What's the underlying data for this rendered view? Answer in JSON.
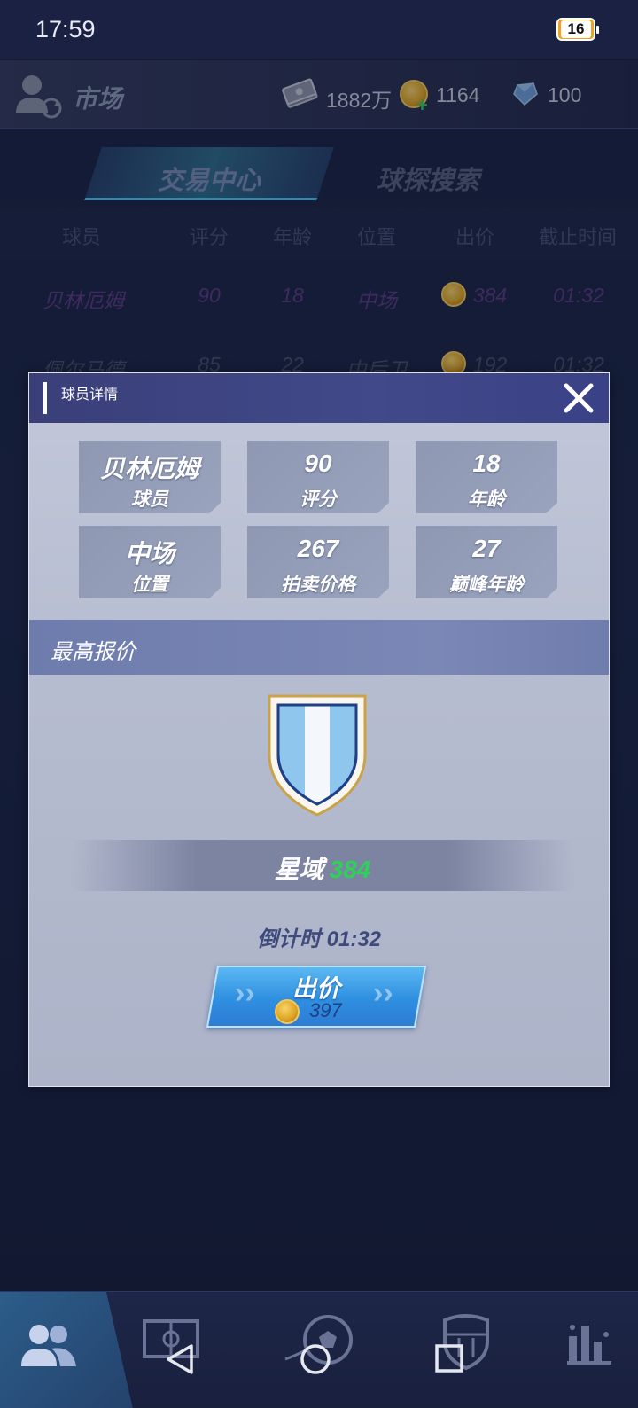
{
  "status_bar": {
    "time": "17:59",
    "battery": "16"
  },
  "header": {
    "title": "市场",
    "cash": "1882万",
    "coins": "1164",
    "gems": "100"
  },
  "tabs": [
    {
      "label": "交易中心",
      "active": true
    },
    {
      "label": "球探搜索",
      "active": false
    }
  ],
  "table": {
    "headers": [
      "球员",
      "评分",
      "年龄",
      "位置",
      "出价",
      "截止时间"
    ],
    "rows": [
      {
        "player": "贝林厄姆",
        "rating": "90",
        "age": "18",
        "position": "中场",
        "bid": "384",
        "deadline": "01:32"
      },
      {
        "player": "佩尔马德",
        "rating": "85",
        "age": "22",
        "position": "中后卫",
        "bid": "192",
        "deadline": "01:32"
      }
    ]
  },
  "dialog": {
    "title": "球员详情",
    "stats": [
      {
        "value": "贝林厄姆",
        "label": "球员"
      },
      {
        "value": "90",
        "label": "评分"
      },
      {
        "value": "18",
        "label": "年龄"
      },
      {
        "value": "中场",
        "label": "位置"
      },
      {
        "value": "267",
        "label": "拍卖价格"
      },
      {
        "value": "27",
        "label": "巅峰年龄"
      }
    ],
    "section_title": "最高报价",
    "top_bidder": "星域",
    "top_bid": "384",
    "countdown": "倒计时 01:32",
    "bid_button": {
      "label": "出价",
      "price": "397"
    }
  },
  "colors": {
    "accent_green": "#2fd05a",
    "button_blue": "#2f8fe0",
    "coin_gold": "#e1a726"
  },
  "icons": [
    "user-refresh-icon",
    "cash-icon",
    "coin-icon",
    "gem-icon",
    "close-icon",
    "team-shield-icon",
    "players-icon",
    "pitch-icon",
    "football-icon",
    "club-crest-icon",
    "stats-icon",
    "back-icon",
    "home-icon",
    "recents-icon"
  ]
}
